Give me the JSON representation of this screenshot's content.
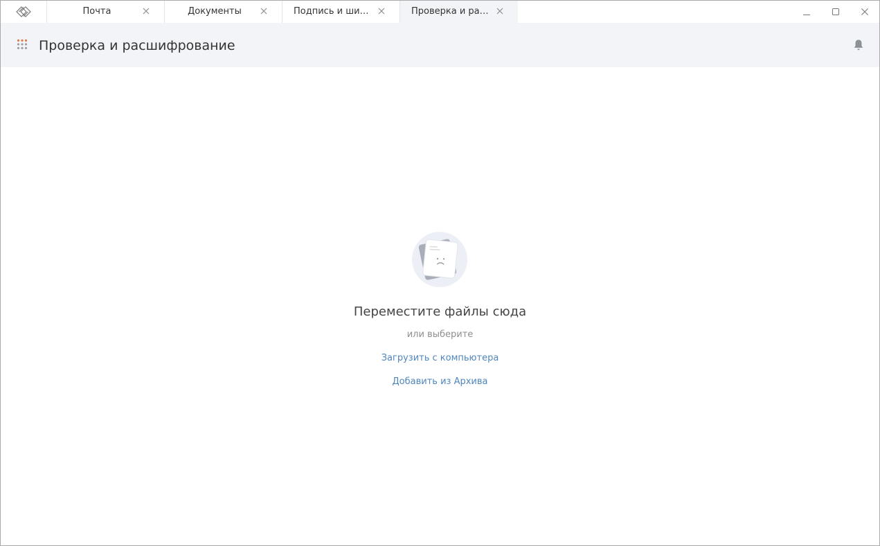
{
  "tabs": [
    {
      "label": "Почта",
      "active": false
    },
    {
      "label": "Документы",
      "active": false
    },
    {
      "label": "Подпись и шиф...",
      "active": false
    },
    {
      "label": "Проверка и рас...",
      "active": true
    }
  ],
  "header": {
    "title": "Проверка и расшифрование"
  },
  "dropzone": {
    "title": "Переместите файлы сюда",
    "or_text": "или выберите",
    "upload_link": "Загрузить с компьютера",
    "archive_link": "Добавить из Архива"
  },
  "colors": {
    "accent_link": "#4e86bd",
    "header_bg": "#f3f4f8",
    "apps_dots": "#e07b4f"
  },
  "icons": {
    "app_logo": "app-logo-icon",
    "tab_close": "close-icon",
    "minimize": "minimize-icon",
    "maximize": "maximize-icon",
    "close": "close-icon",
    "apps": "apps-grid-icon",
    "notifications": "bell-icon",
    "empty_state": "sad-document-icon"
  }
}
